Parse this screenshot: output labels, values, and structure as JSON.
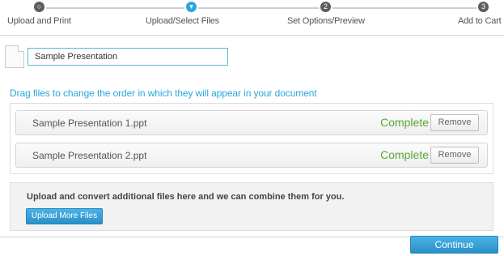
{
  "stepper": {
    "steps": [
      {
        "label": "Upload and Print",
        "icon": "circle"
      },
      {
        "label": "Upload/Select Files",
        "icon": "chevron-down"
      },
      {
        "label": "Set Options/Preview",
        "number": "2"
      },
      {
        "label": "Add to Cart",
        "number": "3"
      }
    ],
    "active_color": "#2aa6dc"
  },
  "document": {
    "title_value": "Sample Presentation"
  },
  "drag_hint": "Drag files to change the order in which they will appear in your document",
  "files": [
    {
      "name": "Sample Presentation 1.ppt",
      "status": "Complete",
      "remove_label": "Remove"
    },
    {
      "name": "Sample Presentation 2.ppt",
      "status": "Complete",
      "remove_label": "Remove"
    }
  ],
  "upload_more": {
    "text": "Upload and convert additional files here and we can combine them for you.",
    "button_label": "Upload More Files"
  },
  "continue_label": "Continue",
  "colors": {
    "accent": "#2aa6dc",
    "status_complete": "#5aa632"
  }
}
